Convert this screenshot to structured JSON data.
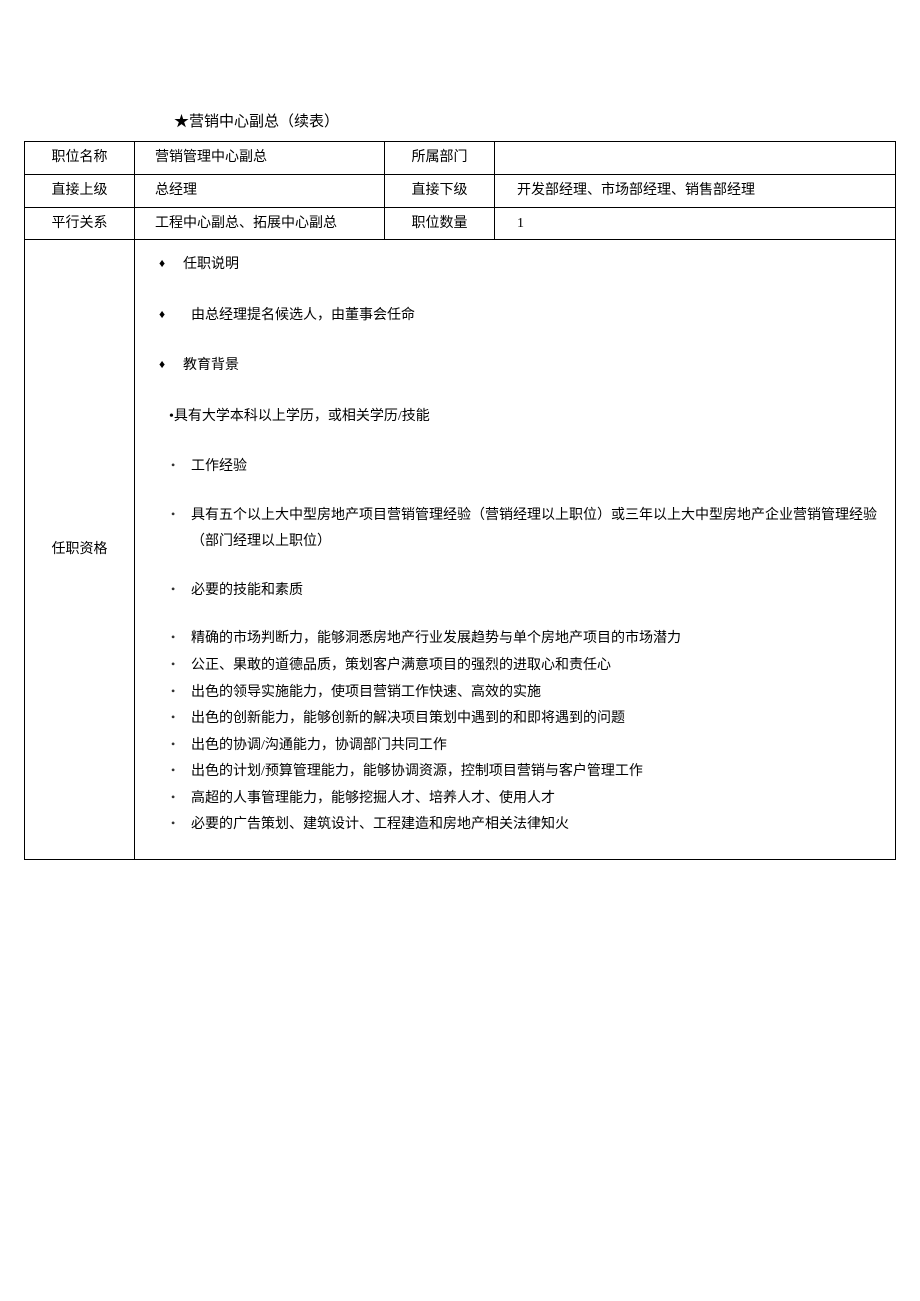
{
  "title": "★营销中心副总（续表）",
  "rows": {
    "r1": {
      "l1": "职位名称",
      "v1": "营销管理中心副总",
      "l2": "所属部门",
      "v2": ""
    },
    "r2": {
      "l1": "直接上级",
      "v1": "总经理",
      "l2": "直接下级",
      "v2": "开发部经理、市场部经理、销售部经理"
    },
    "r3": {
      "l1": "平行关系",
      "v1": "工程中心副总、拓展中心副总",
      "l2": "职位数量",
      "v2": "1"
    }
  },
  "qual_label": "任职资格",
  "diamonds": {
    "d1": "任职说明",
    "d2": "由总经理提名候选人，由董事会任命",
    "d3": "教育背景"
  },
  "edu_line": "•具有大学本科以上学历，或相关学历/技能",
  "dots": {
    "s1": "工作经验",
    "s1_1": "具有五个以上大中型房地产项目营销管理经验（营销经理以上职位）或三年以上大中型房地产企业营销管理经验（部门经理以上职位）",
    "s2": "必要的技能和素质",
    "s2_1": "精确的市场判断力，能够洞悉房地产行业发展趋势与单个房地产项目的市场潜力",
    "s2_2": "公正、果敢的道德品质，策划客户满意项目的强烈的进取心和责任心",
    "s2_3": "出色的领导实施能力，使项目营销工作快速、高效的实施",
    "s2_4": "出色的创新能力，能够创新的解决项目策划中遇到的和即将遇到的问题",
    "s2_5": "出色的协调/沟通能力，协调部门共同工作",
    "s2_6": "出色的计划/预算管理能力，能够协调资源，控制项目营销与客户管理工作",
    "s2_7": "高超的人事管理能力，能够挖掘人才、培养人才、使用人才",
    "s2_8": "必要的广告策划、建筑设计、工程建造和房地产相关法律知火"
  }
}
